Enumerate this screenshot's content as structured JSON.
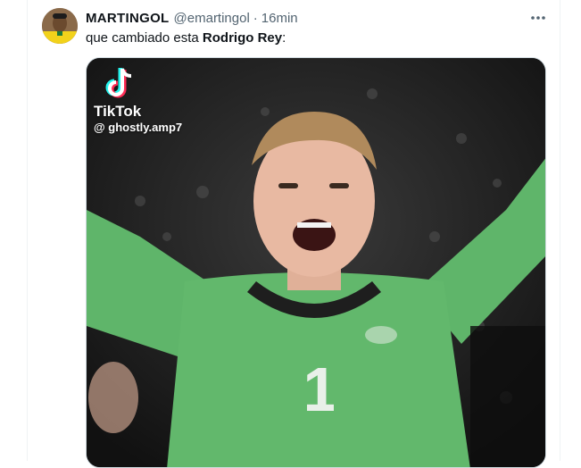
{
  "tweet": {
    "display_name": "MARTINGOL",
    "handle": "@emartingol",
    "separator": "·",
    "time": "16min",
    "text_prefix": "que cambiado esta ",
    "text_bold": "Rodrigo Rey",
    "text_suffix": ":"
  },
  "media": {
    "watermark_brand": "TikTok",
    "watermark_user": "@ ghostly.amp7",
    "jersey_number": "1"
  },
  "icons": {
    "more": "more-horizontal-icon",
    "tiktok": "tiktok-logo-icon"
  },
  "colors": {
    "text_primary": "#0f1419",
    "text_secondary": "#536471",
    "border": "#cfd9de",
    "jersey_green": "#5fb56a"
  }
}
